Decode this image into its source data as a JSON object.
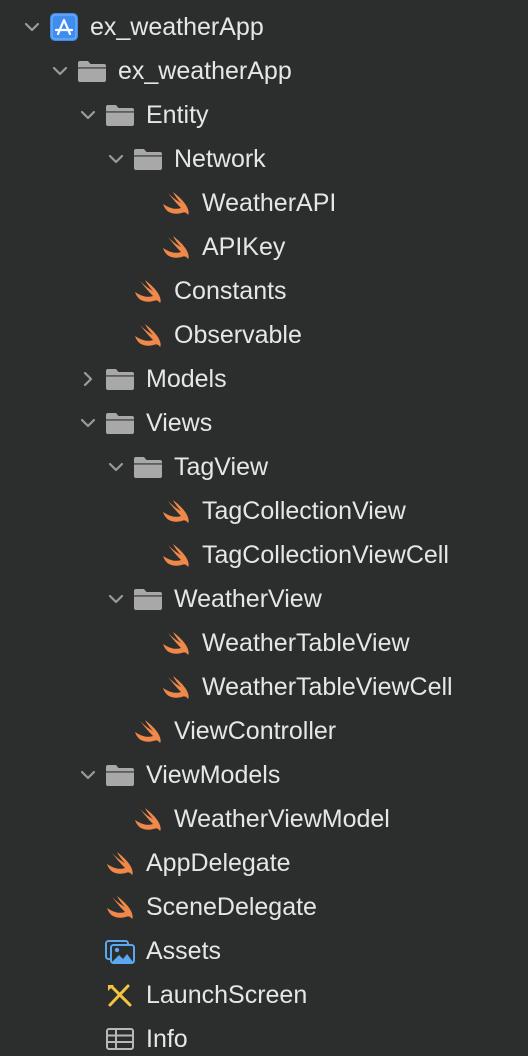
{
  "navigator": {
    "colors": {
      "background": "#2c2e2d",
      "text": "#e6e6e6",
      "folder": "#a8a8a8",
      "swift": "#f0884a",
      "project": "#3e8ef0",
      "assets": "#5aa9f0",
      "chevron": "#9a9a9a"
    },
    "items": [
      {
        "label": "ex_weatherApp",
        "kind": "project",
        "depth": 0,
        "expanded": true
      },
      {
        "label": "ex_weatherApp",
        "kind": "folder",
        "depth": 1,
        "expanded": true
      },
      {
        "label": "Entity",
        "kind": "folder",
        "depth": 2,
        "expanded": true
      },
      {
        "label": "Network",
        "kind": "folder",
        "depth": 3,
        "expanded": true
      },
      {
        "label": "WeatherAPI",
        "kind": "swift",
        "depth": 4
      },
      {
        "label": "APIKey",
        "kind": "swift",
        "depth": 4
      },
      {
        "label": "Constants",
        "kind": "swift",
        "depth": 3
      },
      {
        "label": "Observable",
        "kind": "swift",
        "depth": 3
      },
      {
        "label": "Models",
        "kind": "folder",
        "depth": 2,
        "expanded": false
      },
      {
        "label": "Views",
        "kind": "folder",
        "depth": 2,
        "expanded": true
      },
      {
        "label": "TagView",
        "kind": "folder",
        "depth": 3,
        "expanded": true
      },
      {
        "label": "TagCollectionView",
        "kind": "swift",
        "depth": 4
      },
      {
        "label": "TagCollectionViewCell",
        "kind": "swift",
        "depth": 4
      },
      {
        "label": "WeatherView",
        "kind": "folder",
        "depth": 3,
        "expanded": true
      },
      {
        "label": "WeatherTableView",
        "kind": "swift",
        "depth": 4
      },
      {
        "label": "WeatherTableViewCell",
        "kind": "swift",
        "depth": 4
      },
      {
        "label": "ViewController",
        "kind": "swift",
        "depth": 3
      },
      {
        "label": "ViewModels",
        "kind": "folder",
        "depth": 2,
        "expanded": true
      },
      {
        "label": "WeatherViewModel",
        "kind": "swift",
        "depth": 3
      },
      {
        "label": "AppDelegate",
        "kind": "swift",
        "depth": 2
      },
      {
        "label": "SceneDelegate",
        "kind": "swift",
        "depth": 2
      },
      {
        "label": "Assets",
        "kind": "assets",
        "depth": 2
      },
      {
        "label": "LaunchScreen",
        "kind": "storyboard",
        "depth": 2
      },
      {
        "label": "Info",
        "kind": "plist",
        "depth": 2
      }
    ]
  }
}
